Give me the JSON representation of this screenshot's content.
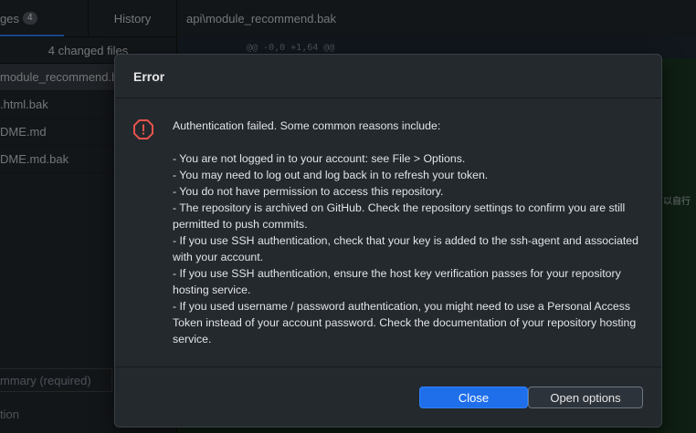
{
  "sidebar": {
    "tab_changes_label": "ges",
    "tab_changes_count": "4",
    "tab_history_label": "History",
    "changed_files": "4 changed files",
    "files": [
      "module_recommend.b",
      ".html.bak",
      "DME.md",
      "DME.md.bak"
    ],
    "summary_placeholder": "mmary (required)",
    "description_placeholder": "tion"
  },
  "main": {
    "file_path": "api\\module_recommend.bak",
    "hunk_header": "@@ -0,0 +1,64 @@",
    "cjk_fragment": "可以自行"
  },
  "dialog": {
    "title": "Error",
    "intro": "Authentication failed. Some common reasons include:",
    "reasons": [
      "- You are not logged in to your account: see File > Options.",
      "- You may need to log out and log back in to refresh your token.",
      "- You do not have permission to access this repository.",
      "- The repository is archived on GitHub. Check the repository settings to confirm you are still permitted to push commits.",
      "- If you use SSH authentication, check that your key is added to the ssh-agent and associated with your account.",
      "- If you use SSH authentication, ensure the host key verification passes for your repository hosting service.",
      "- If you used username / password authentication, you might need to use a Personal Access Token instead of your account password. Check the documentation of your repository hosting service."
    ],
    "close_label": "Close",
    "options_label": "Open options",
    "icon": "error-octagon-icon"
  },
  "colors": {
    "accent": "#1f6feb",
    "error": "#e5534b",
    "background": "#24292e"
  }
}
